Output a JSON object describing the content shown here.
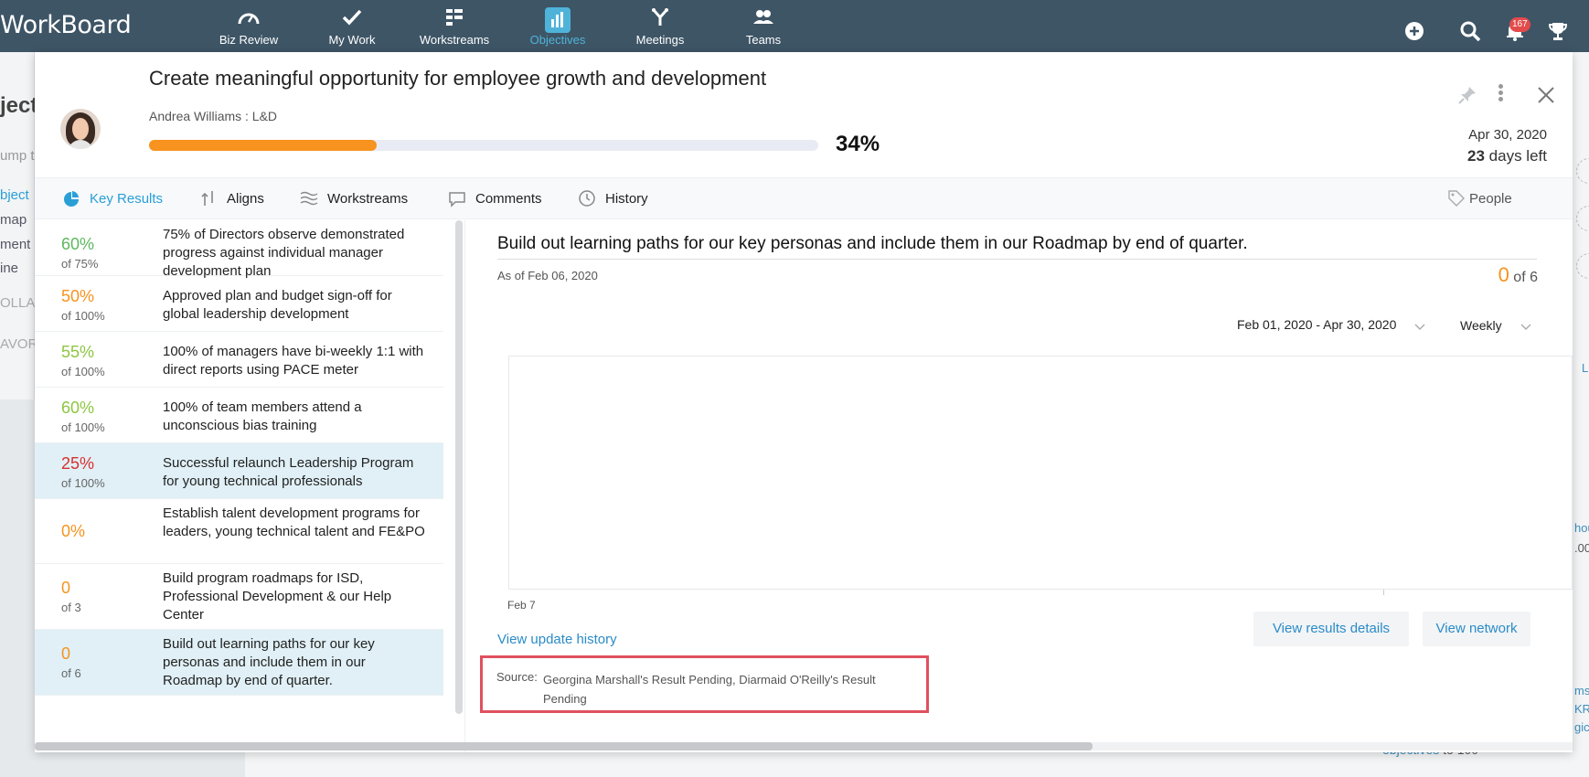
{
  "app": {
    "logo": "WorkBoard",
    "notifications_count": "167"
  },
  "nav": {
    "items": [
      {
        "label": "Biz Review",
        "icon": "gauge-icon"
      },
      {
        "label": "My Work",
        "icon": "checkmark-icon"
      },
      {
        "label": "Workstreams",
        "icon": "workstreams-icon"
      },
      {
        "label": "Objectives",
        "icon": "bar-chart-icon",
        "active": true
      },
      {
        "label": "Meetings",
        "icon": "meetings-icon"
      },
      {
        "label": "Teams",
        "icon": "teams-icon"
      }
    ]
  },
  "background": {
    "left_fragments": [
      "ject",
      "ump t",
      "bject",
      "map",
      "ment",
      "ine",
      "OLLA",
      "AVOR"
    ],
    "right_fragments": [
      "L",
      "hou",
      ".00",
      "ms",
      "KR",
      "gic"
    ],
    "bottom_text": {
      "link": "objectives",
      "rest": " to 100"
    }
  },
  "objective": {
    "title": "Create meaningful opportunity for employee growth and development",
    "owner": "Andrea Williams : L&D",
    "progress": 0.34,
    "progress_label": "34%",
    "due_date": "Apr 30, 2020",
    "days_left_num": "23",
    "days_left_text": " days left"
  },
  "tabs": [
    {
      "label": "Key Results",
      "icon": "pie-icon",
      "active": true
    },
    {
      "label": "Aligns",
      "icon": "aligns-icon"
    },
    {
      "label": "Workstreams",
      "icon": "waves-icon"
    },
    {
      "label": "Comments",
      "icon": "comment-icon"
    },
    {
      "label": "History",
      "icon": "clock-icon"
    }
  ],
  "people_tab": {
    "label": "People",
    "icon": "tag-icon"
  },
  "key_results": [
    {
      "pct": "60%",
      "of": "of 75%",
      "color": "#5cb85c",
      "text": "75% of Directors observe demonstrated progress against individual manager development plan"
    },
    {
      "pct": "50%",
      "of": "of 100%",
      "color": "#f7931e",
      "text": "Approved plan and budget sign-off for global leadership development"
    },
    {
      "pct": "55%",
      "of": "of 100%",
      "color": "#8cc63f",
      "text": "100% of managers have bi-weekly 1:1 with direct reports using PACE meter"
    },
    {
      "pct": "60%",
      "of": "of 100%",
      "color": "#8cc63f",
      "text": "100% of team members attend a unconscious bias training"
    },
    {
      "pct": "25%",
      "of": "of 100%",
      "color": "#d9302c",
      "text": "Successful relaunch Leadership Program for young technical professionals",
      "selected": true
    },
    {
      "pct": "0%",
      "of": "",
      "color": "#f7931e",
      "text": "Establish talent development programs for leaders, young technical talent and FE&PO"
    },
    {
      "pct": "0",
      "of": "of 3",
      "color": "#f7931e",
      "text": "Build program roadmaps for ISD, Professional Development & our Help Center"
    },
    {
      "pct": "0",
      "of": "of 6",
      "color": "#f7931e",
      "text": "Build out learning paths for our key personas and include them in our Roadmap by end of quarter.",
      "selected": true
    }
  ],
  "detail": {
    "title": "Build out learning paths for our key personas and include them in our Roadmap by end of quarter.",
    "as_of": "As of Feb 06, 2020",
    "count_num": "0",
    "count_rest": " of 6",
    "date_range": "Feb 01, 2020 - Apr 30, 2020",
    "period": "Weekly",
    "x_label": "Feb 7",
    "view_history": "View update history",
    "view_results": "View results details",
    "view_network": "View network",
    "source_label": "Source:",
    "source_text": "Georgina Marshall's Result Pending, Diarmaid O'Reilly's Result Pending"
  }
}
